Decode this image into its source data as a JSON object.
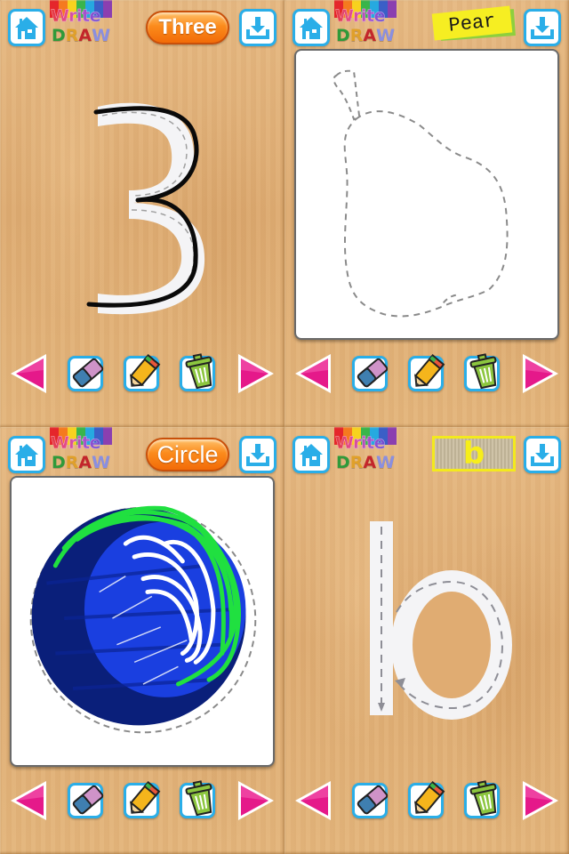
{
  "app": {
    "logo_line1": "Write",
    "logo_line2": [
      "D",
      "R",
      "A",
      "W"
    ],
    "logo_line2_colors": [
      "#2f9a3a",
      "#e0a02a",
      "#c3262b",
      "#8a8fe0"
    ],
    "logo_stripe_colors": [
      "#e5262b",
      "#f57a1f",
      "#f7d21f",
      "#39b54a",
      "#26a9e0",
      "#3b5fc7",
      "#8b3fb0"
    ]
  },
  "colors": {
    "accent_blue": "#2aaee8",
    "arrow_pink": "#e5198a",
    "pill_orange": "#f5821f",
    "tag_yellow": "#f6ee22",
    "tag_green": "#8ecf3d"
  },
  "icons": {
    "home": "home-icon",
    "save": "download-icon",
    "prev": "triangle-left-icon",
    "next": "triangle-right-icon",
    "eraser": "eraser-icon",
    "pencil": "pencil-icon",
    "trash": "trash-icon"
  },
  "panels": [
    {
      "id": "three",
      "title": "Three",
      "title_style": "orange-pill",
      "content_type": "traced-numeral",
      "glyph": "3",
      "has_sheet": false
    },
    {
      "id": "pear",
      "title": "Pear",
      "title_style": "sticky-tag",
      "content_type": "dashed-shape-outline",
      "shape": "pear",
      "has_sheet": true
    },
    {
      "id": "circle",
      "title": "Circle",
      "title_style": "orange-pill",
      "content_type": "colored-drawing",
      "shape": "circle",
      "stroke_colors": [
        "#0a1f7a",
        "#1a3fe0",
        "#20e040",
        "#ffffff"
      ],
      "has_sheet": true
    },
    {
      "id": "letter-b",
      "title": "b",
      "title_style": "cardboard-box",
      "content_type": "traced-letter",
      "glyph": "b",
      "has_sheet": false
    }
  ]
}
